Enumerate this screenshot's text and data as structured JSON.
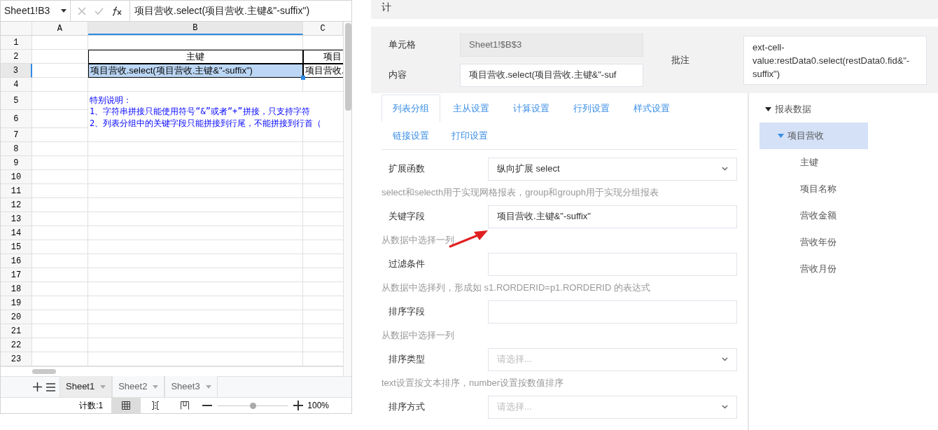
{
  "spreadsheet": {
    "name_box": "Sheet1!B3",
    "formula": "项目营收.select(项目营收.主键&\"-suffix\")",
    "columns": [
      {
        "label": "A",
        "selected": false
      },
      {
        "label": "B",
        "selected": true
      },
      {
        "label": "C",
        "selected": false
      }
    ],
    "rows": [
      {
        "number": "1",
        "selected": false,
        "kind": "plain"
      },
      {
        "number": "2",
        "selected": false,
        "kind": "header",
        "b": "主键",
        "c": "项目"
      },
      {
        "number": "3",
        "selected": true,
        "kind": "data",
        "b": "项目营收.select(项目营收.主键&\"-suffix\")",
        "c": "项目营收."
      },
      {
        "number": "4",
        "selected": false,
        "kind": "plain"
      },
      {
        "number": "5",
        "selected": false,
        "kind": "note",
        "notes": [
          "特别说明：",
          "1、字符串拼接只能使用符号“&”或者“+”拼接，只支持字符"
        ]
      },
      {
        "number": "6",
        "selected": false,
        "kind": "note",
        "notes": [
          "2、列表分组中的关键字段只能拼接到行尾，不能拼接到行首（"
        ]
      },
      {
        "number": "7",
        "selected": false,
        "kind": "plain"
      },
      {
        "number": "8",
        "selected": false,
        "kind": "plain"
      },
      {
        "number": "9",
        "selected": false,
        "kind": "plain"
      },
      {
        "number": "10",
        "selected": false,
        "kind": "plain"
      },
      {
        "number": "11",
        "selected": false,
        "kind": "plain"
      },
      {
        "number": "12",
        "selected": false,
        "kind": "plain"
      },
      {
        "number": "13",
        "selected": false,
        "kind": "plain"
      },
      {
        "number": "14",
        "selected": false,
        "kind": "plain"
      },
      {
        "number": "15",
        "selected": false,
        "kind": "plain"
      },
      {
        "number": "16",
        "selected": false,
        "kind": "plain"
      },
      {
        "number": "17",
        "selected": false,
        "kind": "plain"
      },
      {
        "number": "18",
        "selected": false,
        "kind": "plain"
      },
      {
        "number": "19",
        "selected": false,
        "kind": "plain"
      },
      {
        "number": "20",
        "selected": false,
        "kind": "plain"
      },
      {
        "number": "21",
        "selected": false,
        "kind": "plain"
      },
      {
        "number": "22",
        "selected": false,
        "kind": "plain"
      },
      {
        "number": "23",
        "selected": false,
        "kind": "plain"
      }
    ],
    "sheets": [
      {
        "label": "Sheet1",
        "selected": true
      },
      {
        "label": "Sheet2",
        "selected": false
      },
      {
        "label": "Sheet3",
        "selected": false
      }
    ],
    "status": {
      "count": "计数:1",
      "views": [
        {
          "kind": "normal",
          "selected": true
        },
        {
          "kind": "break",
          "selected": false
        },
        {
          "kind": "page",
          "selected": false
        }
      ],
      "zoom": {
        "level": 0.5,
        "reading": "100%"
      }
    }
  },
  "panel": {
    "title": "计",
    "cell": {
      "label": "单元格",
      "value": "Sheet1!$B$3"
    },
    "content": {
      "label": "内容",
      "value": "项目营收.select(项目营收.主键&\"-suf"
    },
    "comment": {
      "label": "批注",
      "value": "ext-cell-value:restData0.select(restData0.fid&\"-suffix\")"
    },
    "tabs": [
      {
        "label": "列表分组",
        "selected": true
      },
      {
        "label": "主从设置",
        "selected": false
      },
      {
        "label": "计算设置",
        "selected": false
      },
      {
        "label": "行列设置",
        "selected": false
      },
      {
        "label": "样式设置",
        "selected": false
      },
      {
        "label": "链接设置",
        "selected": false
      },
      {
        "label": "打印设置",
        "selected": false
      }
    ],
    "form": [
      {
        "kind": "select",
        "label": "扩展函数",
        "value": "纵向扩展 select"
      },
      {
        "kind": "hint",
        "text": "select和selecth用于实现网格报表，group和grouph用于实现分组报表"
      },
      {
        "kind": "input",
        "label": "关键字段",
        "value": "项目营收.主键&\"-suffix\""
      },
      {
        "kind": "hint",
        "text": "从数据中选择一列"
      },
      {
        "kind": "input",
        "label": "过滤条件"
      },
      {
        "kind": "hint",
        "text": "从数据中选择列，形成如 s1.RORDERID=p1.RORDERID 的表达式"
      },
      {
        "kind": "input",
        "label": "排序字段"
      },
      {
        "kind": "hint",
        "text": "从数据中选择一列"
      },
      {
        "kind": "select",
        "label": "排序类型",
        "placeholder": "请选择..."
      },
      {
        "kind": "hint",
        "text": "text设置按文本排序，number设置按数值排序"
      },
      {
        "kind": "select",
        "label": "排序方式",
        "placeholder": "请选择..."
      }
    ],
    "tree": [
      {
        "label": "报表数据",
        "expanded": true,
        "selected": false,
        "children": [
          {
            "label": "项目营收",
            "expanded": true,
            "selected": true,
            "children": [
              {
                "label": "主键",
                "selected": false
              },
              {
                "label": "项目名称",
                "selected": false
              },
              {
                "label": "营收金额",
                "selected": false
              },
              {
                "label": "营收年份",
                "selected": false
              },
              {
                "label": "营收月份",
                "selected": false
              }
            ]
          }
        ]
      }
    ]
  }
}
